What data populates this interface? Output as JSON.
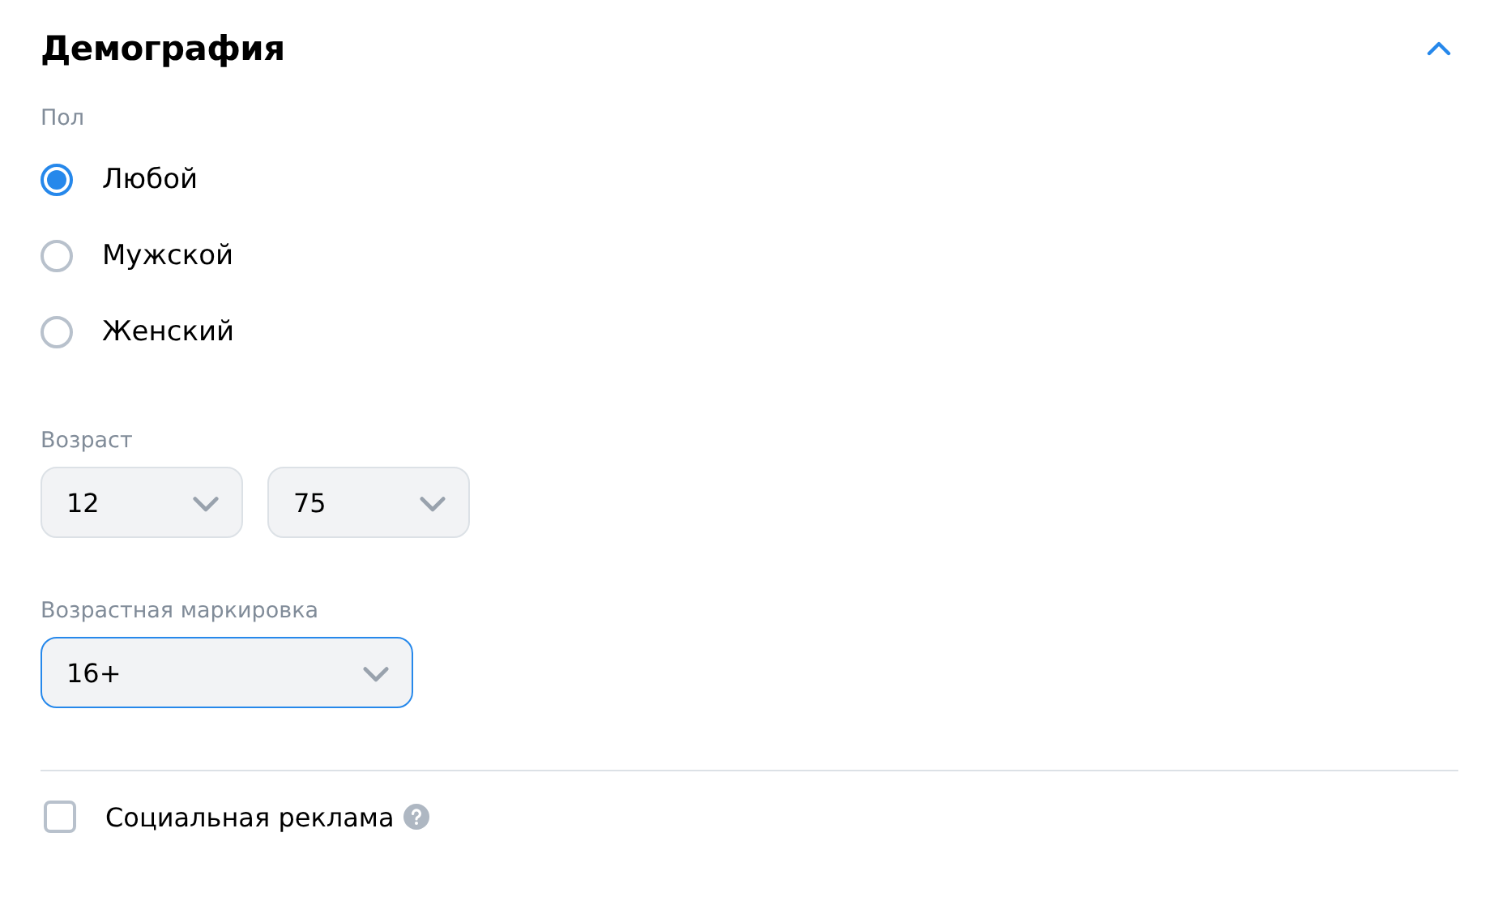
{
  "section": {
    "title": "Демография",
    "expanded": true
  },
  "gender": {
    "label": "Пол",
    "options": [
      {
        "label": "Любой",
        "selected": true
      },
      {
        "label": "Мужской",
        "selected": false
      },
      {
        "label": "Женский",
        "selected": false
      }
    ]
  },
  "age": {
    "label": "Возраст",
    "selects": [
      {
        "value": "12",
        "focused": false
      },
      {
        "value": "75",
        "focused": false
      }
    ]
  },
  "age_rating": {
    "label": "Возрастная маркировка",
    "value": "16+",
    "focused": true
  },
  "social_ad": {
    "label": "Социальная реклама",
    "checked": false
  }
}
